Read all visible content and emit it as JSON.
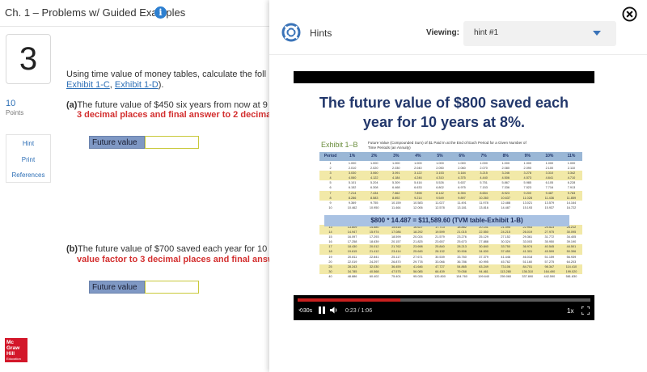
{
  "header": {
    "chapter_title": "Ch. 1 – Problems w/ Guided Examples",
    "info_icon": "info-icon"
  },
  "question": {
    "number": "3",
    "points_value": "10",
    "points_label": "Points",
    "side_links": [
      "Hint",
      "Print",
      "References"
    ],
    "prompt_line1": "Using time value of money tables, calculate the foll",
    "prompt_link1": "Exhibit 1-C",
    "prompt_sep": ", ",
    "prompt_link2": "Exhibit 1-D",
    "prompt_end": ").",
    "part_a_label": "(a)",
    "part_a_text": "The future value of $450 six years from now at 9 p",
    "part_a_red": "3 decimal places and final answer to 2 decimal p",
    "part_a_field_label": "Future value",
    "part_a_field_value": "",
    "part_b_label": "(b)",
    "part_b_text": "The future value of $700 saved each year for 10",
    "part_b_red": "value factor to 3 decimal places and final answer",
    "part_b_field_label": "Future value",
    "part_b_field_value": ""
  },
  "logo": {
    "lines": [
      "Mc",
      "Graw",
      "Hill",
      "Education"
    ]
  },
  "hints_panel": {
    "title": "Hints",
    "viewing_label": "Viewing:",
    "viewing_value": "hint #1",
    "icons": {
      "lifebuoy": "lifebuoy-icon",
      "close": "close-circle-icon",
      "dropdown": "chevron-down-icon"
    },
    "accent_color": "#3a73b8"
  },
  "video": {
    "slide_title_line1": "The future value of $800 saved each",
    "slide_title_line2": "year for 10 years at 8%.",
    "exhibit_label": "Exhibit 1–B",
    "exhibit_subtitle": "Future Value (Compounded Sum) of $1 Paid In at the End of Each Period for a Given Number of Time Periods (an Annuity)",
    "table_headers": [
      "Period",
      "1%",
      "2%",
      "3%",
      "4%",
      "5%",
      "6%",
      "7%",
      "8%",
      "9%",
      "10%",
      "11%"
    ],
    "table_rows": [
      [
        "1",
        "1.000",
        "1.000",
        "1.000",
        "1.000",
        "1.000",
        "1.000",
        "1.000",
        "1.000",
        "1.000",
        "1.000",
        "1.000"
      ],
      [
        "2",
        "2.010",
        "2.020",
        "2.030",
        "2.040",
        "2.050",
        "2.060",
        "2.070",
        "2.080",
        "2.090",
        "2.100",
        "2.110"
      ],
      [
        "3",
        "3.030",
        "3.060",
        "3.091",
        "3.122",
        "3.153",
        "3.184",
        "3.215",
        "3.246",
        "3.278",
        "3.310",
        "3.342"
      ],
      [
        "4",
        "4.060",
        "4.122",
        "4.184",
        "4.246",
        "4.310",
        "4.375",
        "4.440",
        "4.506",
        "4.573",
        "4.641",
        "4.710"
      ],
      [
        "5",
        "5.101",
        "5.204",
        "5.309",
        "5.416",
        "5.526",
        "5.637",
        "5.751",
        "5.867",
        "5.985",
        "6.105",
        "6.228"
      ],
      [
        "6",
        "6.152",
        "6.308",
        "6.468",
        "6.633",
        "6.802",
        "6.975",
        "7.153",
        "7.336",
        "7.523",
        "7.716",
        "7.913"
      ],
      [
        "7",
        "7.214",
        "7.434",
        "7.662",
        "7.898",
        "8.142",
        "8.394",
        "8.654",
        "8.923",
        "9.200",
        "9.487",
        "9.783"
      ],
      [
        "8",
        "8.286",
        "8.583",
        "8.892",
        "9.214",
        "9.549",
        "9.897",
        "10.260",
        "10.637",
        "11.028",
        "11.436",
        "11.859"
      ],
      [
        "9",
        "9.369",
        "9.755",
        "10.159",
        "10.583",
        "11.027",
        "11.491",
        "11.978",
        "12.488",
        "13.021",
        "13.579",
        "14.164"
      ],
      [
        "10",
        "10.462",
        "10.950",
        "11.464",
        "12.006",
        "12.578",
        "13.181",
        "13.816",
        "14.487",
        "15.193",
        "15.937",
        "16.722"
      ],
      [
        "13",
        "13.809",
        "14.680",
        "15.618",
        "16.627",
        "17.713",
        "18.882",
        "20.141",
        "21.495",
        "22.953",
        "24.523",
        "26.212"
      ],
      [
        "14",
        "14.947",
        "15.974",
        "17.086",
        "18.292",
        "19.599",
        "21.015",
        "22.550",
        "24.215",
        "26.019",
        "27.975",
        "30.095"
      ],
      [
        "15",
        "16.097",
        "17.293",
        "18.599",
        "20.024",
        "21.579",
        "23.276",
        "25.129",
        "27.152",
        "29.361",
        "31.772",
        "34.405"
      ],
      [
        "16",
        "17.258",
        "18.639",
        "20.157",
        "21.825",
        "23.657",
        "25.673",
        "27.888",
        "30.324",
        "33.003",
        "35.950",
        "39.190"
      ],
      [
        "17",
        "18.430",
        "20.012",
        "21.762",
        "23.698",
        "25.840",
        "28.213",
        "30.840",
        "33.750",
        "36.974",
        "40.545",
        "44.501"
      ],
      [
        "18",
        "19.615",
        "21.412",
        "23.414",
        "25.645",
        "28.132",
        "30.906",
        "34.000",
        "37.450",
        "41.301",
        "45.599",
        "50.396"
      ],
      [
        "19",
        "20.811",
        "22.841",
        "25.117",
        "27.671",
        "30.539",
        "33.760",
        "37.379",
        "41.446",
        "46.018",
        "51.159",
        "56.939"
      ],
      [
        "20",
        "22.019",
        "24.297",
        "26.870",
        "29.778",
        "33.066",
        "36.786",
        "40.995",
        "45.762",
        "51.160",
        "57.275",
        "64.203"
      ],
      [
        "25",
        "28.243",
        "32.030",
        "36.459",
        "41.646",
        "47.727",
        "54.865",
        "63.249",
        "73.106",
        "84.701",
        "98.347",
        "114.410"
      ],
      [
        "30",
        "34.785",
        "40.568",
        "47.575",
        "56.085",
        "66.439",
        "79.058",
        "94.461",
        "113.280",
        "136.310",
        "164.490",
        "199.020"
      ],
      [
        "40",
        "48.886",
        "60.402",
        "75.401",
        "95.026",
        "120.800",
        "154.760",
        "199.640",
        "259.060",
        "337.890",
        "442.590",
        "581.830"
      ]
    ],
    "formula": "$800 * 14.487 = $11,589.60 (TVM table-Exhibit 1-B)",
    "rewind_label": "30s",
    "time_text": "0:23 / 1:06",
    "progress": 0.35,
    "speed_label": "1x",
    "progress_color": "#c8201f"
  }
}
